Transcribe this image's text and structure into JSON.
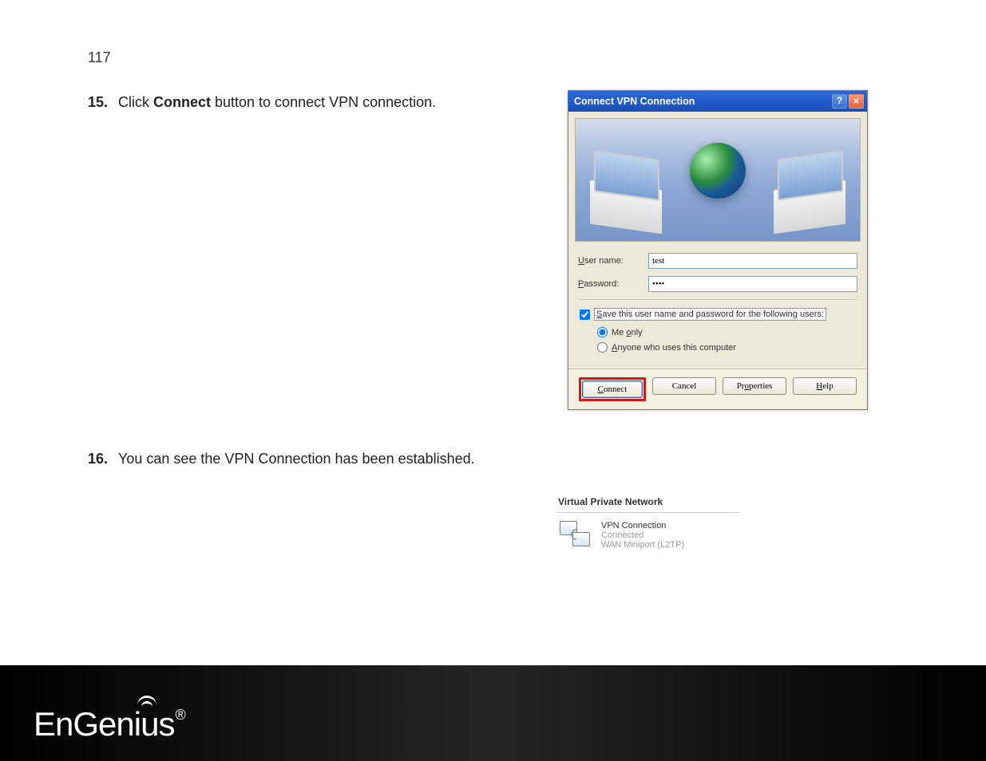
{
  "page_number": "117",
  "steps": {
    "s15": {
      "num": "15.",
      "before": "Click ",
      "bold": "Connect",
      "after": " button to connect VPN connection."
    },
    "s16": {
      "num": "16.",
      "text": "You can see the VPN Connection has been established."
    }
  },
  "dialog": {
    "title": "Connect VPN Connection",
    "username_label": "User name:",
    "username_underline": "U",
    "username_value": "test",
    "password_label": "Password:",
    "password_underline": "P",
    "password_value": "••••",
    "save_label": "Save this user name and password for the following users:",
    "save_underline": "S",
    "save_checked": true,
    "radio_me_label": "Me only",
    "radio_me_underline": "o",
    "radio_anyone_label": "Anyone who uses this computer",
    "radio_anyone_underline": "A",
    "radio_selected": "me",
    "buttons": {
      "connect": "Connect",
      "connect_underline": "C",
      "cancel": "Cancel",
      "properties": "Properties",
      "properties_underline": "o",
      "help": "Help",
      "help_underline": "H"
    }
  },
  "vpn_panel": {
    "header": "Virtual Private Network",
    "line1": "VPN Connection",
    "line2": "Connected",
    "line3": "WAN Miniport (L2TP)"
  },
  "brand": "EnGenius",
  "brand_mark": "®"
}
